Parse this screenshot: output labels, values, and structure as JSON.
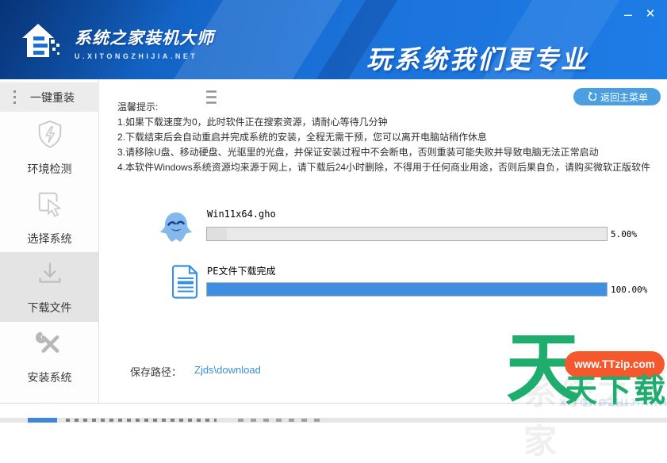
{
  "window": {
    "minimize_glyph": "–",
    "close_glyph": "✕"
  },
  "header": {
    "logo_title": "系统之家装机大师",
    "logo_subtitle": "U.XITONGZHIJIA.NET",
    "slogan": "玩系统我们更专业"
  },
  "sidebar": {
    "header_label": "一键重装",
    "items": [
      {
        "label": "环境检测",
        "icon": "shield-bolt-icon",
        "selected": false
      },
      {
        "label": "选择系统",
        "icon": "cursor-select-icon",
        "selected": false
      },
      {
        "label": "下载文件",
        "icon": "download-icon",
        "selected": true
      },
      {
        "label": "安装系统",
        "icon": "tools-icon",
        "selected": false
      }
    ]
  },
  "main": {
    "return_button_label": "返回主菜单",
    "tips": {
      "title": "温馨提示:",
      "lines": [
        "1.如果下载速度为0，此时软件正在搜索资源，请耐心等待几分钟",
        "2.下载结束后会自动重启并完成系统的安装，全程无需干预，您可以离开电脑站稍作休息",
        "3.请移除U盘、移动硬盘、光驱里的光盘，并保证安装过程中不会断电，否则重装可能失败并导致电脑无法正常启动",
        "4.本软件Windows系统资源均来源于网上，请下载后24小时删除，不得用于任何商业用途，否则后果自负，请购买微软正版软件"
      ]
    },
    "downloads": [
      {
        "name": "Win11x64.gho",
        "icon": "ghost-mascot-icon",
        "percent": 5,
        "percent_label": "5.00%"
      },
      {
        "name": "PE文件下载完成",
        "icon": "file-document-icon",
        "percent": 100,
        "percent_label": "100.00%"
      }
    ],
    "save_path_label": "保存路径：",
    "save_path_value": "Zjds\\download"
  },
  "watermark": {
    "big_char": "天",
    "pill_text": "www.TTzip.com",
    "sub_text": "天下载",
    "bg_text": "系统之家",
    "bg_sub_text": "XITONGZHIJIA.NET"
  },
  "colors": {
    "header_blue": "#1b73da",
    "progress_blue": "#3e8ee2",
    "button_blue": "#4b9fe1",
    "link_blue": "#3a8fd8",
    "watermark_green": "#1fad6e",
    "watermark_orange": "#f4582c",
    "selected_gray": "#e4e4e4"
  }
}
